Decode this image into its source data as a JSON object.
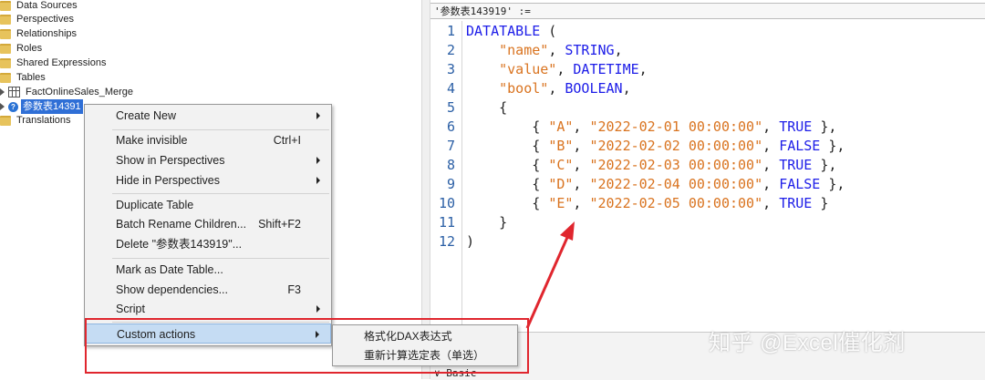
{
  "tree": {
    "items": [
      {
        "label": "Data Sources"
      },
      {
        "label": "Perspectives"
      },
      {
        "label": "Relationships"
      },
      {
        "label": "Roles"
      },
      {
        "label": "Shared Expressions"
      },
      {
        "label": "Tables"
      },
      {
        "label": "FactOnlineSales_Merge"
      },
      {
        "label": "参数表14391"
      },
      {
        "label": "Translations"
      }
    ]
  },
  "context_menu": {
    "create_new": "Create New",
    "make_invisible": "Make invisible",
    "make_invisible_shortcut": "Ctrl+I",
    "show_in_perspectives": "Show in Perspectives",
    "hide_in_perspectives": "Hide in Perspectives",
    "duplicate_table": "Duplicate Table",
    "batch_rename": "Batch Rename Children...",
    "batch_rename_shortcut": "Shift+F2",
    "delete": "Delete \"参数表143919\"...",
    "mark_as_date_table": "Mark as Date Table...",
    "show_dependencies": "Show dependencies...",
    "show_dependencies_shortcut": "F3",
    "script": "Script",
    "custom_actions": "Custom actions"
  },
  "submenu": {
    "format_dax": "格式化DAX表达式",
    "recalc_table": "重新计算选定表（单选）"
  },
  "editor": {
    "expression_header": "'参数表143919' :=",
    "line_numbers": [
      "1",
      "2",
      "3",
      "4",
      "5",
      "6",
      "7",
      "8",
      "9",
      "10",
      "11",
      "12"
    ],
    "datatable_kw": "DATATABLE",
    "open_paren": " (",
    "close_paren": ")",
    "col_name": "\"name\"",
    "col_value": "\"value\"",
    "col_bool": "\"bool\"",
    "type_string": "STRING",
    "type_datetime": "DATETIME",
    "type_boolean": "BOOLEAN",
    "open_brace": "{",
    "close_brace": "}",
    "rows": [
      {
        "key": "\"A\"",
        "date": "\"2022-02-01 00:00:00\"",
        "flag": "TRUE",
        "end": " },"
      },
      {
        "key": "\"B\"",
        "date": "\"2022-02-02 00:00:00\"",
        "flag": "FALSE",
        "end": " },"
      },
      {
        "key": "\"C\"",
        "date": "\"2022-02-03 00:00:00\"",
        "flag": "TRUE",
        "end": " },"
      },
      {
        "key": "\"D\"",
        "date": "\"2022-02-04 00:00:00\"",
        "flag": "FALSE",
        "end": " },"
      },
      {
        "key": "\"E\"",
        "date": "\"2022-02-05 00:00:00\"",
        "flag": "TRUE",
        "end": " }"
      }
    ],
    "bottom_label": "∨ Basic"
  },
  "watermark": "知乎 @Excel催化剂",
  "colors": {
    "keyword": "#1d1de8",
    "string": "#d9731f",
    "annotation": "#e0262e",
    "selection": "#2f6fd6",
    "menu_highlight": "#c5dcf3"
  }
}
